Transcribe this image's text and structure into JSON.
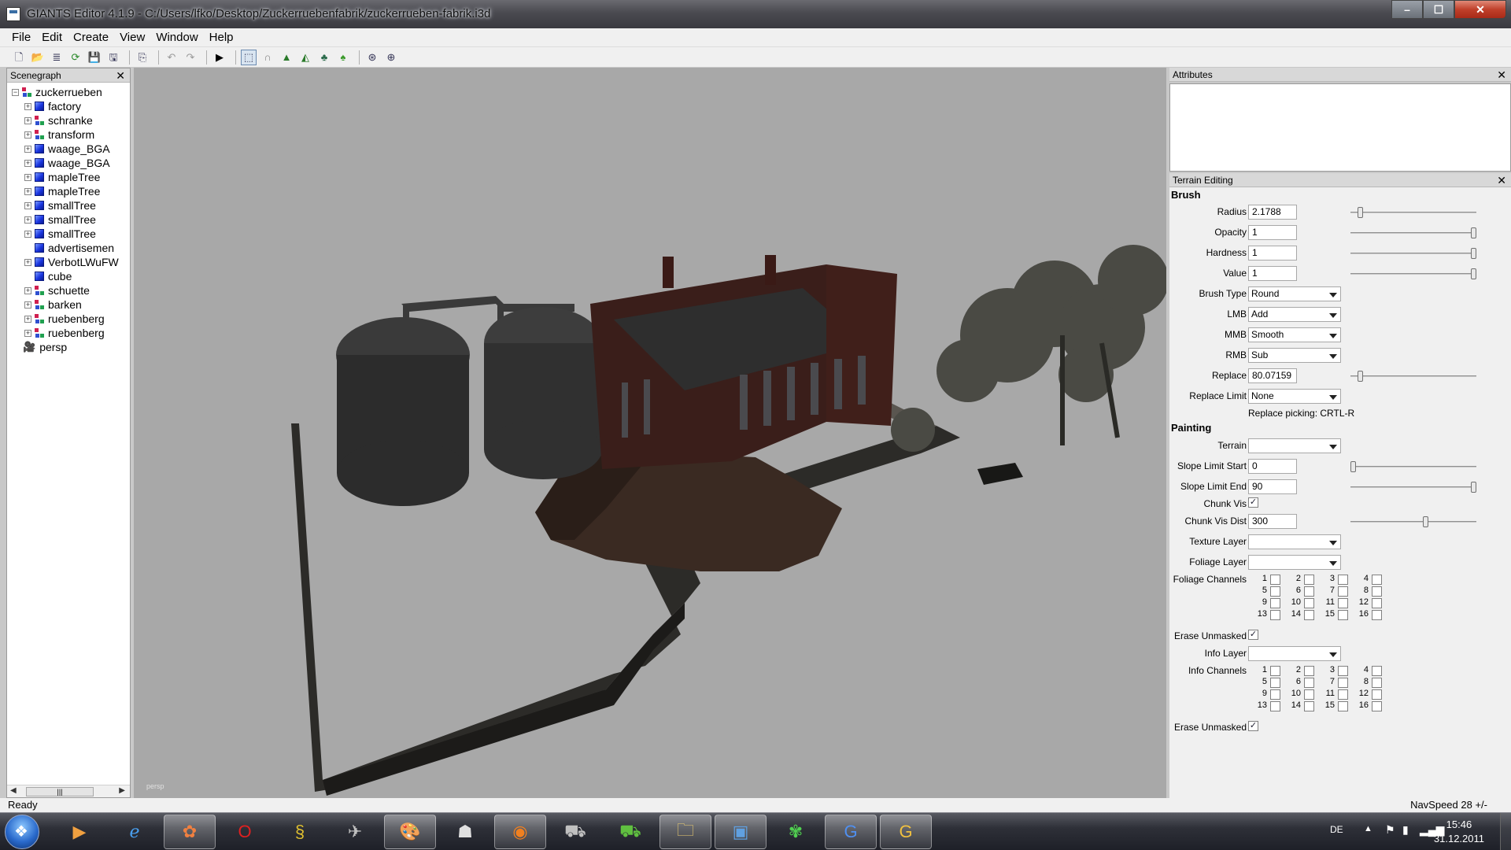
{
  "window": {
    "title": "GIANTS Editor 4.1.9 - C:/Users/lfko/Desktop/Zuckerruebenfabrik/zuckerrueben-fabrik.i3d",
    "minimize": "–",
    "maximize": "☐",
    "close": "✕"
  },
  "menu": {
    "items": [
      "File",
      "Edit",
      "Create",
      "View",
      "Window",
      "Help"
    ]
  },
  "toolbar": {
    "buttons": [
      "new-icon",
      "open-icon",
      "import-icon",
      "reload-icon",
      "save-icon",
      "save-all-icon",
      "export-icon",
      "undo-icon",
      "redo-icon",
      "play-icon",
      "select-icon",
      "move-icon",
      "terrain-raise-icon",
      "terrain-paint-icon",
      "terrain-foliage-icon",
      "terrain-grass-icon",
      "snap-icon",
      "grid-icon"
    ]
  },
  "scenegraph": {
    "title": "Scenegraph",
    "close": "✕",
    "root": "zuckerrueben",
    "items": [
      {
        "label": "factory",
        "icon": "cube-icon",
        "expandable": true
      },
      {
        "label": "schranke",
        "icon": "transform-icon",
        "expandable": true
      },
      {
        "label": "transform",
        "icon": "transform-icon",
        "expandable": true
      },
      {
        "label": "waage_BGA",
        "icon": "cube-icon",
        "expandable": true
      },
      {
        "label": "waage_BGA",
        "icon": "cube-icon",
        "expandable": true
      },
      {
        "label": "mapleTree",
        "icon": "cube-icon",
        "expandable": true
      },
      {
        "label": "mapleTree",
        "icon": "cube-icon",
        "expandable": true
      },
      {
        "label": "smallTree",
        "icon": "cube-icon",
        "expandable": true
      },
      {
        "label": "smallTree",
        "icon": "cube-icon",
        "expandable": true
      },
      {
        "label": "smallTree",
        "icon": "cube-icon",
        "expandable": true
      },
      {
        "label": "advertisemen",
        "icon": "cube-icon",
        "expandable": false
      },
      {
        "label": "VerbotLWuFW",
        "icon": "cube-icon",
        "expandable": true
      },
      {
        "label": "cube",
        "icon": "cube-icon",
        "expandable": false
      },
      {
        "label": "schuette",
        "icon": "transform-icon",
        "expandable": true
      },
      {
        "label": "barken",
        "icon": "transform-icon",
        "expandable": true
      },
      {
        "label": "ruebenberg",
        "icon": "transform-icon",
        "expandable": true
      },
      {
        "label": "ruebenberg",
        "icon": "transform-icon",
        "expandable": true
      }
    ],
    "camera": "persp"
  },
  "viewport": {
    "label": "persp"
  },
  "attributes": {
    "title": "Attributes",
    "close": "✕"
  },
  "terrain": {
    "title": "Terrain Editing",
    "close": "✕",
    "brush_heading": "Brush",
    "radius_label": "Radius",
    "radius": "2.1788",
    "radius_level": 0.06,
    "opacity_label": "Opacity",
    "opacity": "1",
    "opacity_level": 1.0,
    "hardness_label": "Hardness",
    "hardness": "1",
    "hardness_level": 1.0,
    "value_label": "Value",
    "value": "1",
    "value_level": 1.0,
    "brush_type_label": "Brush Type",
    "brush_type": "Round",
    "lmb_label": "LMB",
    "lmb": "Add",
    "mmb_label": "MMB",
    "mmb": "Smooth",
    "rmb_label": "RMB",
    "rmb": "Sub",
    "replace_label": "Replace",
    "replace": "80.07159",
    "replace_level": 0.06,
    "replace_limit_label": "Replace Limit",
    "replace_limit": "None",
    "replace_picking": "Replace picking: CRTL-R",
    "painting_heading": "Painting",
    "terrain_label": "Terrain",
    "terrain_value": "",
    "slope_start_label": "Slope Limit Start",
    "slope_start": "0",
    "slope_start_level": 0.0,
    "slope_end_label": "Slope Limit End",
    "slope_end": "90",
    "slope_end_level": 1.0,
    "chunk_vis_label": "Chunk Vis",
    "chunk_vis": "✓",
    "chunk_dist_label": "Chunk Vis Dist",
    "chunk_dist": "300",
    "chunk_dist_level": 0.6,
    "texture_layer_label": "Texture Layer",
    "texture_layer": "",
    "foliage_layer_label": "Foliage Layer",
    "foliage_layer": "",
    "foliage_channels_label": "Foliage Channels",
    "channels": [
      "1",
      "2",
      "3",
      "4",
      "5",
      "6",
      "7",
      "8",
      "9",
      "10",
      "11",
      "12",
      "13",
      "14",
      "15",
      "16"
    ],
    "erase_unmasked_label": "Erase Unmasked",
    "erase_unmasked": "✓",
    "info_layer_label": "Info Layer",
    "info_layer": "",
    "info_channels_label": "Info Channels",
    "erase_unmasked2_label": "Erase Unmasked",
    "erase_unmasked2": "✓"
  },
  "status": {
    "text": "Ready",
    "nav": "NavSpeed 28 +/-"
  },
  "taskbar": {
    "apps": [
      "media-player-icon",
      "internet-explorer-icon",
      "paint-app-icon",
      "opera-icon",
      "scroll-app-icon",
      "game-app-icon",
      "paint-palette-icon",
      "agent-app-icon",
      "firefox-icon",
      "tractor-icon",
      "tractor-green-icon",
      "folder-icon",
      "editor-icon",
      "icq-icon",
      "giants-blue-icon",
      "giants-yellow-icon"
    ],
    "lang": "DE",
    "time": "15:46",
    "date": "31.12.2011"
  },
  "colors": {
    "viewport": "#a8a8a8",
    "panel": "#f0f0f0",
    "taskbar": "#2e3038"
  }
}
